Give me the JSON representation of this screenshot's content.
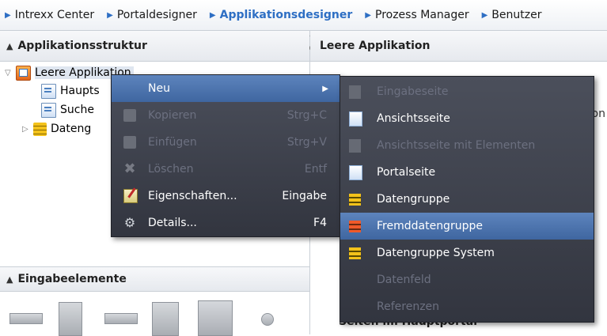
{
  "topnav": {
    "items": [
      {
        "label": "Intrexx Center",
        "active": false
      },
      {
        "label": "Portaldesigner",
        "active": false
      },
      {
        "label": "Applikationsdesigner",
        "active": true
      },
      {
        "label": "Prozess Manager",
        "active": false
      },
      {
        "label": "Benutzer",
        "active": false
      }
    ]
  },
  "left_panel": {
    "title": "Applikationsstruktur",
    "tree": {
      "root": "Leere Applikation",
      "children": [
        "Haupts",
        "Suche",
        "Dateng"
      ]
    },
    "elements_title": "Eingabeelemente"
  },
  "right_panel": {
    "title": "Leere Applikation",
    "partial_text": "on",
    "bottom_text": "Seiten im Hauptportal"
  },
  "context_menu": {
    "items": [
      {
        "label": "Neu",
        "shortcut": "",
        "enabled": true,
        "has_submenu": true,
        "icon": "none"
      },
      {
        "label": "Kopieren",
        "shortcut": "Strg+C",
        "enabled": false,
        "icon": "copy-icon"
      },
      {
        "label": "Einfügen",
        "shortcut": "Strg+V",
        "enabled": false,
        "icon": "paste-icon"
      },
      {
        "label": "Löschen",
        "shortcut": "Entf",
        "enabled": false,
        "icon": "delete-icon"
      },
      {
        "label": "Eigenschaften...",
        "shortcut": "Eingabe",
        "enabled": true,
        "icon": "properties-icon"
      },
      {
        "label": "Details...",
        "shortcut": "F4",
        "enabled": true,
        "icon": "details-icon"
      }
    ]
  },
  "submenu": {
    "items": [
      {
        "label": "Eingabeseite",
        "enabled": false,
        "icon": "page-icon"
      },
      {
        "label": "Ansichtsseite",
        "enabled": true,
        "icon": "page-icon"
      },
      {
        "label": "Ansichtsseite mit Elementen",
        "enabled": false,
        "icon": "page-icon"
      },
      {
        "label": "Portalseite",
        "enabled": true,
        "icon": "page-icon"
      },
      {
        "label": "Datengruppe",
        "enabled": true,
        "icon": "datagroup-icon"
      },
      {
        "label": "Fremddatengruppe",
        "enabled": true,
        "highlighted": true,
        "icon": "foreign-datagroup-icon"
      },
      {
        "label": "Datengruppe System",
        "enabled": true,
        "icon": "datagroup-icon"
      },
      {
        "label": "Datenfeld",
        "enabled": false,
        "icon": "none"
      },
      {
        "label": "Referenzen",
        "enabled": false,
        "icon": "none"
      }
    ]
  },
  "colors": {
    "accent": "#2e6fc4",
    "menu_bg": "#3e414c",
    "menu_highlight": "#4f76b0",
    "menu_disabled_text": "#6c7080"
  }
}
